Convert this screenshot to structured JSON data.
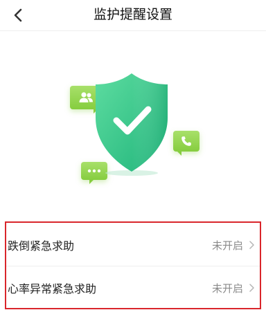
{
  "header": {
    "title": "监护提醒设置"
  },
  "illustration": {
    "icons": [
      "users-icon",
      "phone-icon",
      "chat-dots-icon",
      "shield-check-icon"
    ],
    "colors": {
      "shield_light": "#5ddcA0",
      "shield_dark": "#1fb47a",
      "bubble": "#86cd3f"
    }
  },
  "settings": {
    "items": [
      {
        "label": "跌倒紧急求助",
        "value": "未开启"
      },
      {
        "label": "心率异常紧急求助",
        "value": "未开启"
      }
    ],
    "highlight_color": "#d9252b"
  }
}
